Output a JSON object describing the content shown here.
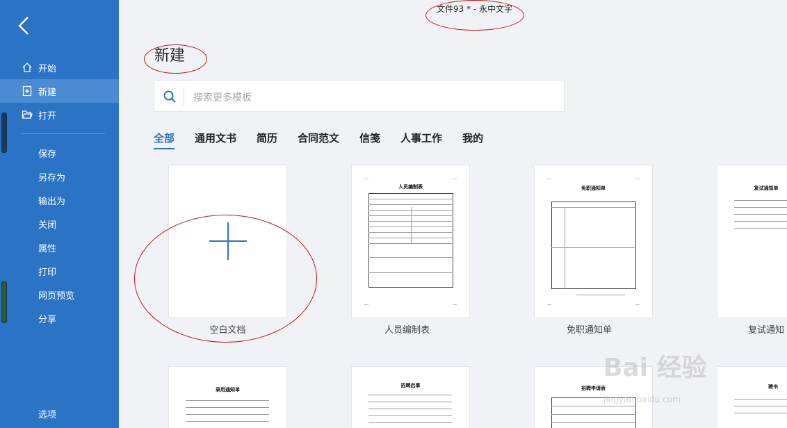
{
  "window_title": "文件93 * - 永中文字",
  "sidebar": {
    "primary": [
      {
        "label": "开始",
        "icon": "home-icon"
      },
      {
        "label": "新建",
        "icon": "new-doc-icon",
        "active": true
      },
      {
        "label": "打开",
        "icon": "folder-open-icon"
      }
    ],
    "secondary": [
      {
        "label": "保存"
      },
      {
        "label": "另存为"
      },
      {
        "label": "输出为"
      },
      {
        "label": "关闭"
      },
      {
        "label": "属性"
      },
      {
        "label": "打印"
      },
      {
        "label": "网页预览"
      },
      {
        "label": "分享"
      }
    ],
    "options_label": "选项"
  },
  "main": {
    "title": "新建",
    "search_placeholder": "搜索更多模板",
    "tabs": [
      "全部",
      "通用文书",
      "简历",
      "合同范文",
      "信笺",
      "人事工作",
      "我的"
    ],
    "templates": [
      {
        "label": "空白文档"
      },
      {
        "label": "人员编制表",
        "doc_title": "人员编制表"
      },
      {
        "label": "免职通知单",
        "doc_title": "免职通知单"
      },
      {
        "label": "复试通知",
        "doc_title": "复试通知单"
      },
      {
        "doc_title": "录用通知单"
      },
      {
        "doc_title": "招聘启事"
      },
      {
        "doc_title": "招聘申请表"
      },
      {
        "doc_title": "聘书"
      }
    ]
  },
  "watermark": {
    "brand": "Bai 经验",
    "url": "jingyan.baidu.com"
  },
  "colors": {
    "sidebar": "#2b73c4",
    "active": "#4a8bd4",
    "annotation": "#c0151b",
    "accent": "#2b73c4"
  }
}
